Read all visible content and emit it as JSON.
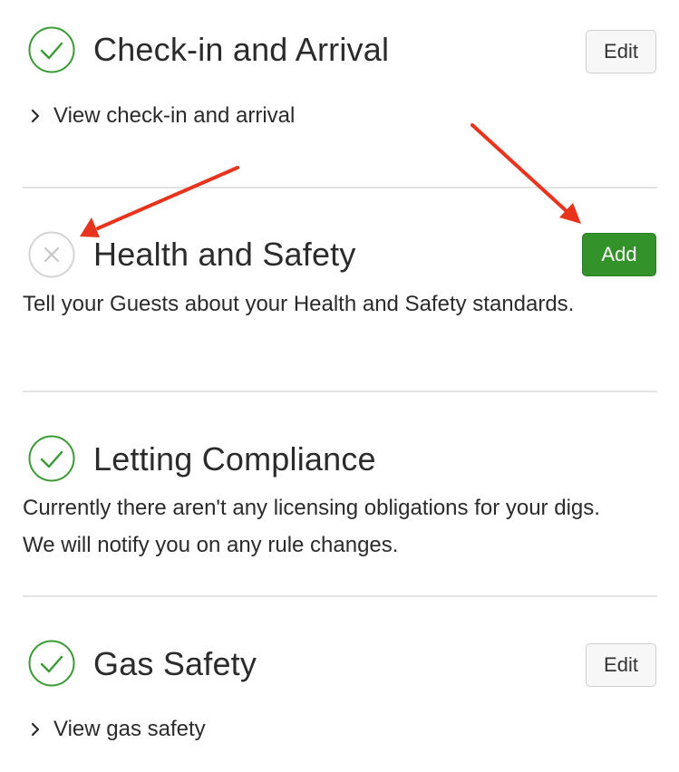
{
  "colors": {
    "check": "#3a9a34",
    "add_button": "#33922a",
    "arrow": "#e8341c",
    "x_icon": "#d4d4d4"
  },
  "sections": [
    {
      "title": "Check-in and Arrival",
      "status": "complete",
      "icon": "check-circle-icon",
      "button": "Edit",
      "link": "View check-in and arrival"
    },
    {
      "title": "Health and Safety",
      "status": "incomplete",
      "icon": "x-circle-icon",
      "button": "Add",
      "description": "Tell your Guests about your Health and Safety standards."
    },
    {
      "title": "Letting Compliance",
      "status": "complete",
      "icon": "check-circle-icon",
      "description": "Currently there aren't any licensing obligations for your digs. We will notify you on any rule changes."
    },
    {
      "title": "Gas Safety",
      "status": "complete",
      "icon": "check-circle-icon",
      "button": "Edit",
      "link": "View gas safety"
    }
  ]
}
